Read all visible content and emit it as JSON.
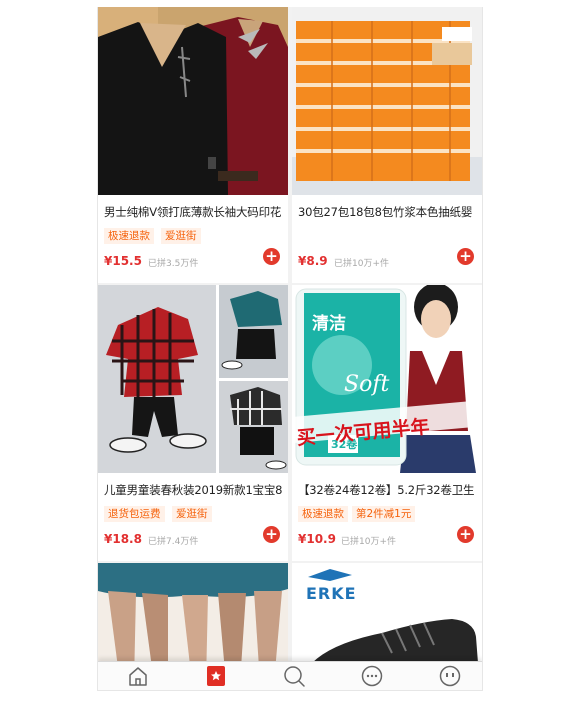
{
  "products": [
    {
      "title": "男士纯棉V领打底薄款长袖大码印花",
      "tags": [
        "极速退款",
        "爱逛街"
      ],
      "price": "¥15.5",
      "sold": "已拼3.5万件",
      "image_icon": "shirts-photo"
    },
    {
      "title": "30包27包18包8包竹浆本色抽纸婴",
      "tags": [],
      "price": "¥8.9",
      "sold": "已拼10万+件",
      "image_icon": "tissue-boxes-photo"
    },
    {
      "title": "儿童男童装春秋装2019新款1宝宝8",
      "tags": [
        "退货包运费",
        "爱逛街"
      ],
      "price": "¥18.8",
      "sold": "已拼7.4万件",
      "image_icon": "kids-outfit-photo"
    },
    {
      "title": "【32卷24卷12卷】5.2斤32卷卫生",
      "tags": [
        "极速退款",
        "第2件减1元"
      ],
      "price": "¥10.9",
      "sold": "已拼10万+件",
      "image_icon": "toilet-paper-photo",
      "image_text": {
        "brand": "清洁",
        "script": "Soft",
        "badge": "32卷",
        "banner": "买一次可用半年"
      }
    },
    {
      "title": "",
      "tags": [],
      "price": "",
      "sold": "",
      "image_icon": "legs-skirt-photo"
    },
    {
      "title": "",
      "tags": [],
      "price": "",
      "sold": "",
      "image_icon": "sneaker-photo",
      "image_text": {
        "brand": "ERKE"
      }
    }
  ],
  "add_button_symbol": "+",
  "tabbar": {
    "active_index": 1,
    "items": [
      "home-icon",
      "bookmark-icon",
      "search-icon",
      "chat-icon",
      "profile-icon"
    ]
  },
  "colors": {
    "price_red": "#e23030",
    "tag_orange": "#f5620c",
    "tag_bg": "#fff1e8",
    "active_tab_red": "#e02e24"
  }
}
